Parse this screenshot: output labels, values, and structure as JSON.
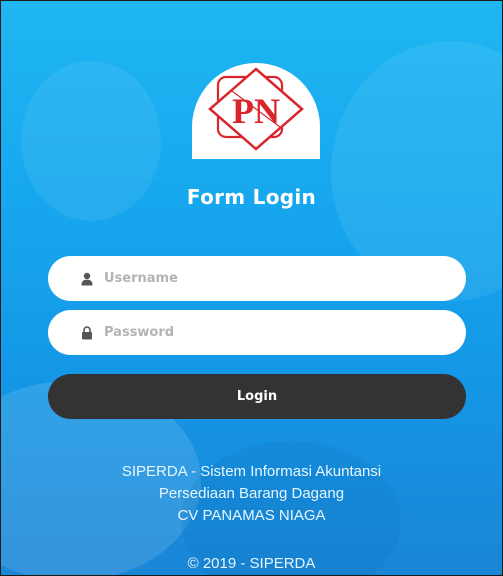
{
  "logo": {
    "text": "PN",
    "icon": "pn-logo-icon"
  },
  "form": {
    "title": "Form Login",
    "username": {
      "placeholder": "Username",
      "value": "",
      "icon": "user-icon"
    },
    "password": {
      "placeholder": "Password",
      "value": "",
      "icon": "lock-icon"
    },
    "login_label": "Login"
  },
  "footer": {
    "line1": "SIPERDA - Sistem Informasi Akuntansi",
    "line2": "Persediaan Barang Dagang",
    "line3": "CV PANAMAS NIAGA",
    "copyright": "© 2019 - SIPERDA"
  },
  "colors": {
    "background": "#17a7ee",
    "button": "#333333",
    "logo_red": "#d9262c"
  }
}
